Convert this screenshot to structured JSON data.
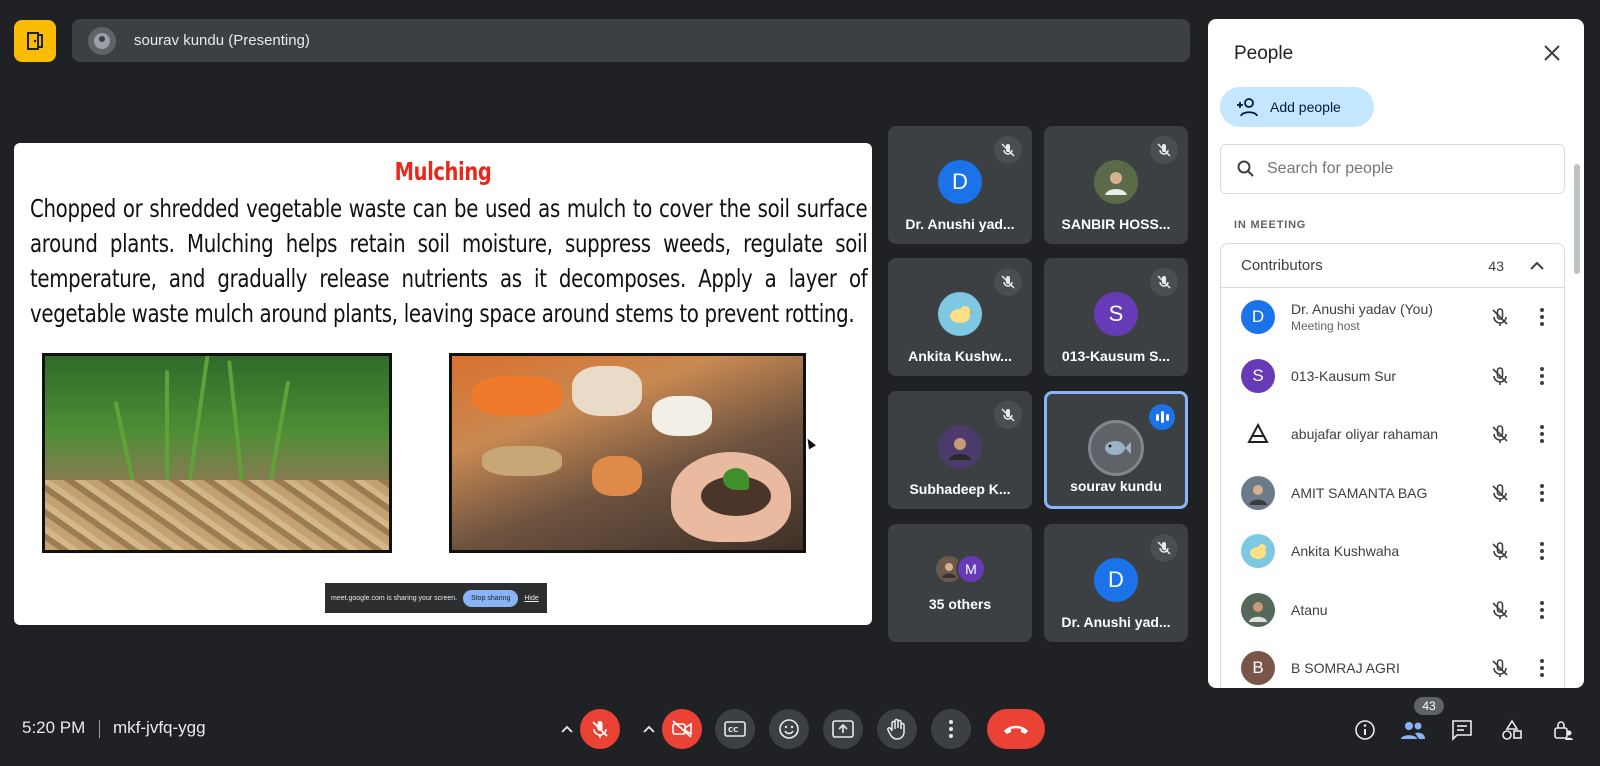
{
  "top_bar": {
    "presenter_label": "sourav kundu (Presenting)"
  },
  "slide": {
    "title": "Mulching",
    "body": "Chopped or shredded vegetable waste can be used as mulch to cover the soil surface around plants. Mulching helps retain soil moisture, suppress weeds, regulate soil temperature, and gradually release nutrients as it decomposes. Apply a layer of vegetable waste mulch around plants, leaving space around stems to prevent rotting.",
    "share_banner": {
      "text": "meet.google.com is sharing your screen.",
      "stop_label": "Stop sharing",
      "hide_label": "Hide"
    }
  },
  "tiles": [
    {
      "name": "Dr. Anushi yad...",
      "initial": "D",
      "color": "#1a73e8",
      "muted": true
    },
    {
      "name": "SANBIR HOSS...",
      "initial": "",
      "color": "#5b6b4a",
      "muted": true
    },
    {
      "name": "Ankita Kushw...",
      "initial": "",
      "color": "#7ec8e3",
      "muted": true
    },
    {
      "name": "013-Kausum S...",
      "initial": "S",
      "color": "#673ab7",
      "muted": true
    },
    {
      "name": "Subhadeep K...",
      "initial": "",
      "color": "#4a3b6b",
      "muted": true
    },
    {
      "name": "sourav kundu",
      "initial": "",
      "color": "#5f6368",
      "muted": false,
      "speaking": true
    },
    {
      "name": "35 others",
      "initial": "M",
      "color": "#673ab7",
      "muted": false
    },
    {
      "name": "Dr. Anushi yad...",
      "initial": "D",
      "color": "#1a73e8",
      "muted": true
    }
  ],
  "panel": {
    "title": "People",
    "add_label": "Add people",
    "search_placeholder": "Search for people",
    "section_label": "IN MEETING",
    "group_label": "Contributors",
    "group_count": "43",
    "people": [
      {
        "name": "Dr. Anushi yadav (You)",
        "sub": "Meeting host",
        "initial": "D",
        "color": "#1a73e8"
      },
      {
        "name": "013-Kausum Sur",
        "sub": "",
        "initial": "S",
        "color": "#673ab7"
      },
      {
        "name": "abujafar oliyar rahaman",
        "sub": "",
        "initial": "",
        "color": "#ffffff"
      },
      {
        "name": "AMIT SAMANTA BAG",
        "sub": "",
        "initial": "",
        "color": "#6b7b8a"
      },
      {
        "name": "Ankita Kushwaha",
        "sub": "",
        "initial": "",
        "color": "#7ec8e3"
      },
      {
        "name": "Atanu",
        "sub": "",
        "initial": "",
        "color": "#55695a"
      },
      {
        "name": "B SOMRAJ AGRI",
        "sub": "",
        "initial": "B",
        "color": "#795548"
      }
    ]
  },
  "bottom_bar": {
    "time": "5:20 PM",
    "meeting_code": "mkf-jvfq-ygg",
    "people_count": "43"
  },
  "colors": {
    "background": "#202124",
    "surface": "#3c4043",
    "danger": "#ea4335",
    "accent": "#8ab4f8",
    "logo": "#fbbc04"
  }
}
